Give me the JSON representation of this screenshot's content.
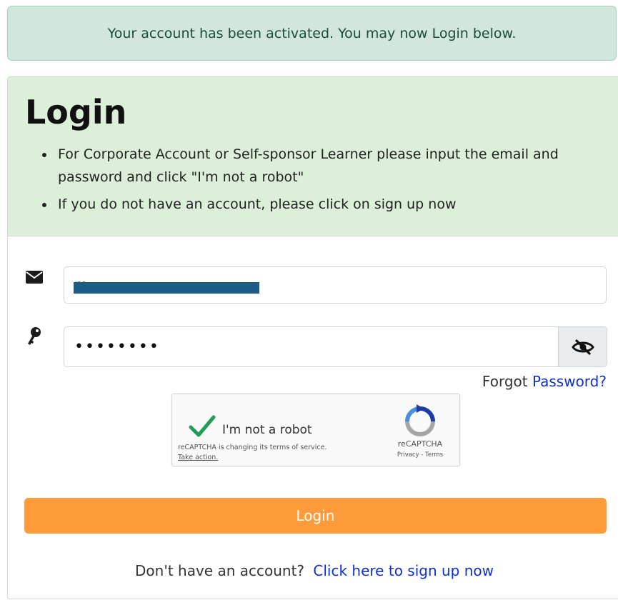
{
  "alert": {
    "message": "Your account has been activated. You may now Login below."
  },
  "header": {
    "title": "Login",
    "bullets": [
      "For Corporate Account or Self-sponsor Learner please input the email and password and click \"I'm not a robot\"",
      "If you do not have an account, please click on sign up now"
    ]
  },
  "form": {
    "email_icon": "envelope-icon",
    "email_value": "m",
    "password_icon": "key-icon",
    "password_value": "••••••••",
    "toggle_icon": "eye-slash-icon",
    "forgot_prefix": "Forgot",
    "forgot_link": "Password?"
  },
  "recaptcha": {
    "label": "I'm not a robot",
    "notice": "reCAPTCHA is changing its terms of service.",
    "take_action": "Take action.",
    "brand": "reCAPTCHA",
    "links": "Privacy - Terms",
    "check_color": "#1f9d55"
  },
  "actions": {
    "login_label": "Login",
    "signup_prompt": "Don't have an account?",
    "signup_link": "Click here to sign up now"
  },
  "colors": {
    "alert_bg": "#d1e7dd",
    "header_bg": "#dcefd8",
    "accent": "#fd9b3a",
    "link": "#0d2fd8"
  }
}
